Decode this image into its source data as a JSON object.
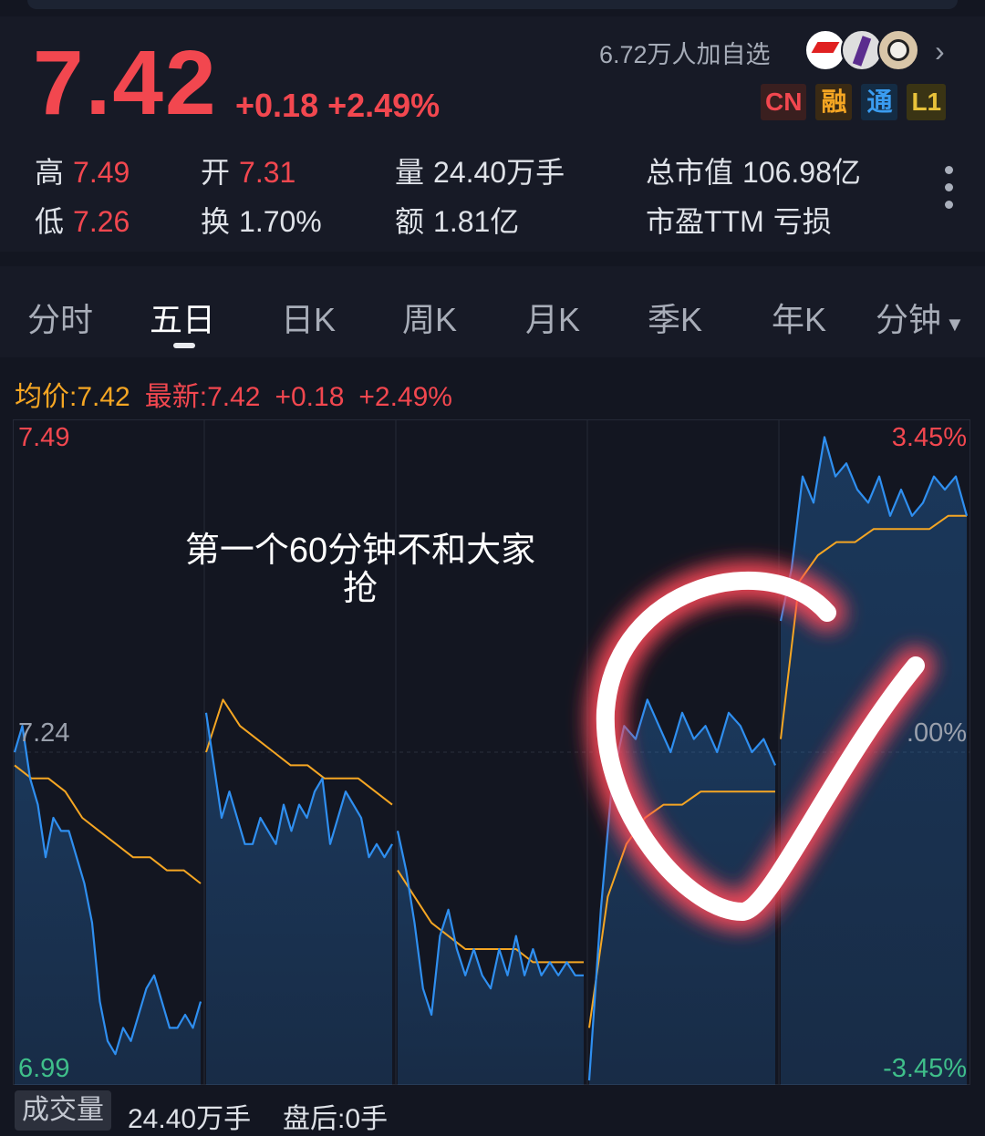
{
  "quote": {
    "price": "7.42",
    "change": "+0.18",
    "change_pct": "+2.49%",
    "watchers": "6.72万人加自选",
    "badges": [
      "CN",
      "融",
      "通",
      "L1"
    ],
    "stats": {
      "high_label": "高",
      "high": "7.49",
      "low_label": "低",
      "low": "7.26",
      "open_label": "开",
      "open": "7.31",
      "turnover_label": "换",
      "turnover": "1.70%",
      "volume_label": "量",
      "volume": "24.40万手",
      "amount_label": "额",
      "amount": "1.81亿",
      "mktcap_label": "总市值",
      "mktcap": "106.98亿",
      "pe_label": "市盈TTM",
      "pe": "亏损"
    }
  },
  "tabs": [
    "分时",
    "五日",
    "日K",
    "周K",
    "月K",
    "季K",
    "年K",
    "分钟"
  ],
  "active_tab": "五日",
  "info": {
    "avg_label": "均价:7.42",
    "latest_label": "最新:7.42",
    "latest_change": "+0.18",
    "latest_pct": "+2.49%"
  },
  "chart_labels": {
    "price_top": "7.49",
    "price_mid": "7.24",
    "price_bottom": "6.99",
    "pct_top": "3.45%",
    "pct_mid": ".00%",
    "pct_bottom": "-3.45%"
  },
  "annotation": "第一个60分钟不和大家抢",
  "volume_bar": {
    "button": "成交量",
    "volume": "24.40万手",
    "after_hours": "盘后:0手"
  },
  "colors": {
    "up": "#f2474f",
    "down": "#3fbf8a",
    "price_line": "#2f8ff0",
    "avg_line": "#f5a623",
    "background": "#131621"
  },
  "chart_data": {
    "type": "line",
    "ylim": [
      6.99,
      7.49
    ],
    "pct_range": [
      -3.45,
      3.45
    ],
    "reference": 7.24,
    "x": [
      "day1",
      "day2",
      "day3",
      "day4",
      "day5"
    ],
    "series": [
      {
        "values": [
          [
            7.24,
            7.26,
            7.22,
            7.2,
            7.16,
            7.19,
            7.18,
            7.18,
            7.16,
            7.14,
            7.11,
            7.05,
            7.02,
            7.01,
            7.03,
            7.02,
            7.04,
            7.06,
            7.07,
            7.05,
            7.03,
            7.03,
            7.04,
            7.03,
            7.05
          ],
          [
            7.27,
            7.23,
            7.19,
            7.21,
            7.19,
            7.17,
            7.17,
            7.19,
            7.18,
            7.17,
            7.2,
            7.18,
            7.2,
            7.19,
            7.21,
            7.22,
            7.17,
            7.19,
            7.21,
            7.2,
            7.19,
            7.16,
            7.17,
            7.16,
            7.17
          ],
          [
            7.18,
            7.15,
            7.11,
            7.06,
            7.04,
            7.1,
            7.12,
            7.09,
            7.07,
            7.09,
            7.07,
            7.06,
            7.09,
            7.07,
            7.1,
            7.07,
            7.09,
            7.07,
            7.08,
            7.07,
            7.08,
            7.07,
            7.07
          ],
          [
            6.99,
            7.12,
            7.22,
            7.26,
            7.25,
            7.28,
            7.26,
            7.24,
            7.27,
            7.25,
            7.26,
            7.24,
            7.27,
            7.26,
            7.24,
            7.25,
            7.23
          ],
          [
            7.34,
            7.38,
            7.45,
            7.43,
            7.48,
            7.45,
            7.46,
            7.44,
            7.43,
            7.45,
            7.42,
            7.44,
            7.42,
            7.43,
            7.45,
            7.44,
            7.45,
            7.42
          ]
        ]
      },
      {
        "values": [
          [
            7.23,
            7.22,
            7.22,
            7.21,
            7.19,
            7.18,
            7.17,
            7.16,
            7.16,
            7.15,
            7.15,
            7.14
          ],
          [
            7.24,
            7.28,
            7.26,
            7.25,
            7.24,
            7.23,
            7.23,
            7.22,
            7.22,
            7.22,
            7.21,
            7.2
          ],
          [
            7.15,
            7.13,
            7.11,
            7.1,
            7.09,
            7.09,
            7.09,
            7.09,
            7.08,
            7.08,
            7.08,
            7.08
          ],
          [
            7.03,
            7.13,
            7.17,
            7.19,
            7.2,
            7.2,
            7.21,
            7.21,
            7.21,
            7.21,
            7.21
          ],
          [
            7.25,
            7.37,
            7.39,
            7.4,
            7.4,
            7.41,
            7.41,
            7.41,
            7.41,
            7.42,
            7.42
          ]
        ]
      }
    ]
  }
}
